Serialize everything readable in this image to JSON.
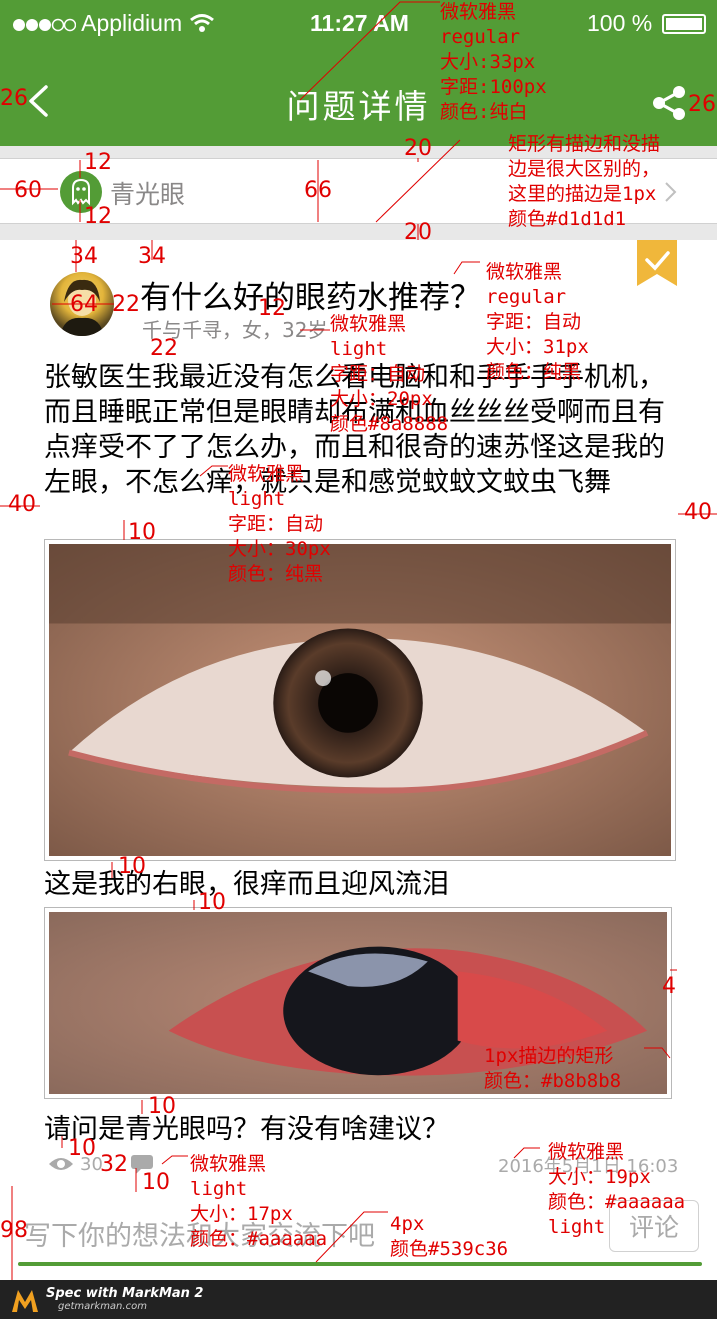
{
  "status": {
    "carrier": "Applidium",
    "time": "11:27 AM",
    "battery": "100 %"
  },
  "header": {
    "title": "问题详情"
  },
  "category": {
    "label": "青光眼"
  },
  "question": {
    "title": "有什么好的眼药水推荐？",
    "meta": "千与千寻，女，32岁",
    "body1": "张敏医生我最近没有怎么看电脑和和手手手手机机，而且睡眠正常但是眼睛却布满和血丝丝丝受啊而且有点痒受不了了怎么办，而且和很奇的速苏怪这是我的左眼，不怎么痒，就只是和感觉蚊蚊文蚊虫飞舞",
    "caption2": "这是我的右眼，很痒而且迎风流泪",
    "caption3": "请问是青光眼吗？有没有啥建议？",
    "views": "30",
    "datetime": "2016年5月1日 16:03"
  },
  "input": {
    "placeholder": "写下你的想法和大家交流下吧",
    "send_label": "评论"
  },
  "markman": {
    "line1": "Spec with MarkMan 2",
    "line2": "getmarkman.com"
  },
  "colors": {
    "brand": "#539c36",
    "border": "#d1d1d1",
    "photo_border": "#b8b8b8",
    "meta": "#8a8888",
    "muted": "#aaaaaa",
    "annotation": "#e00000"
  },
  "annotations": {
    "title_font": "微软雅黑\nregular\n大小:33px\n字距:100px\n颜色:纯白",
    "border_note": "矩形有描边和没描\n边是很大区别的，\n这里的描边是1px\n颜色#d1d1d1",
    "qtitle_font": "微软雅黑\nregular\n字距：自动\n大小：31px\n颜色：纯黑",
    "meta_font": "微软雅黑\nlight\n字距：自动\n大小：20px\n颜色#8a8888",
    "body_font": "微软雅黑\nlight\n字距：自动\n大小：30px\n颜色：纯黑",
    "photo_border": "1px描边的矩形\n颜色：#b8b8b8",
    "footer_font": "微软雅黑\nlight\n大小：17px\n颜色：#aaaaaa",
    "line_note": "4px\n颜色#539c36",
    "date_font": "微软雅黑\n大小：19px\n颜色：#aaaaaa\nlight",
    "n26a": "26",
    "n26b": "26",
    "n60": "60",
    "n12a": "12",
    "n12b": "12",
    "n66": "66",
    "n20a": "20",
    "n20b": "20",
    "n34a": "34",
    "n34b": "34",
    "n64": "64",
    "n22a": "22",
    "n12c": "12",
    "n22b": "22",
    "n40a": "40",
    "n40b": "40",
    "n10a": "10",
    "n10b": "10",
    "n10c": "10",
    "n4": "4",
    "n10d": "10",
    "n10e": "10",
    "n32": "32",
    "n10f": "10",
    "n98": "98"
  }
}
